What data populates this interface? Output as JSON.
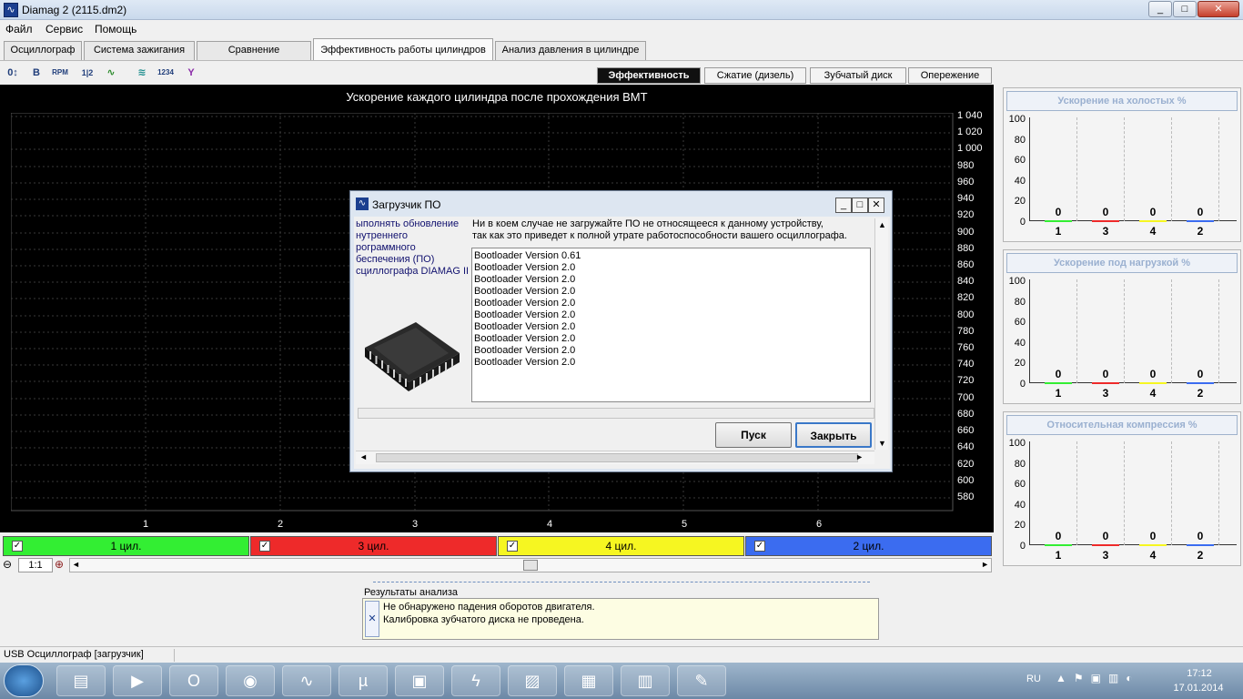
{
  "window": {
    "title": "Diamag 2 (2115.dm2)",
    "app_icon": "oscilloscope-wave-icon",
    "min": "_",
    "max": "□",
    "close": "✕"
  },
  "menu": [
    "Файл",
    "Сервис",
    "Помощь"
  ],
  "tabs": [
    "Осциллограф",
    "Система зажигания",
    "Сравнение цилиндров",
    "Эффективность работы цилиндров",
    "Анализ давления в цилиндре"
  ],
  "active_tab": 3,
  "toolbar": {
    "tools": [
      "0↕",
      "B",
      "RPM",
      "1|2",
      "∿",
      "≋",
      "1234",
      "Y"
    ],
    "subtabs": [
      "Эффективность",
      "Сжатие (дизель)",
      "Зубчатый диск",
      "Опережение"
    ],
    "active_subtab": 0
  },
  "chart": {
    "title": "Ускорение каждого цилиндра после прохождения ВМТ",
    "background": "#000000"
  },
  "chart_data": {
    "type": "bar",
    "title": "Ускорение каждого цилиндра после прохождения ВМТ",
    "categories": [
      "1",
      "2",
      "3",
      "4",
      "5",
      "6"
    ],
    "yticks": [
      "1 040",
      "1 020",
      "1 000",
      "980",
      "960",
      "940",
      "920",
      "900",
      "880",
      "860",
      "840",
      "820",
      "800",
      "780",
      "760",
      "740",
      "720",
      "700",
      "680",
      "660",
      "640",
      "620",
      "600",
      "580"
    ],
    "ylim": [
      580,
      1040
    ],
    "values": []
  },
  "cylinders": [
    {
      "label": "1 цил.",
      "color": "#33ee33"
    },
    {
      "label": "3 цил.",
      "color": "#ee2a2a"
    },
    {
      "label": "4 цил.",
      "color": "#f6f621"
    },
    {
      "label": "2 цил.",
      "color": "#3b6cf0"
    }
  ],
  "checkbox_mark": "✓",
  "scroll": {
    "zoom": "1:1",
    "zoom_out": "⊖",
    "zoom_in": "⊕",
    "left": "◄",
    "right": "►"
  },
  "mini_charts": [
    {
      "title": "Ускорение на холостых %",
      "yticks": [
        "100",
        "80",
        "60",
        "40",
        "20",
        "0"
      ],
      "xlabels": [
        "1",
        "3",
        "4",
        "2"
      ],
      "values": [
        "0",
        "0",
        "0",
        "0"
      ]
    },
    {
      "title": "Ускорение под нагрузкой %",
      "yticks": [
        "100",
        "80",
        "60",
        "40",
        "20",
        "0"
      ],
      "xlabels": [
        "1",
        "3",
        "4",
        "2"
      ],
      "values": [
        "0",
        "0",
        "0",
        "0"
      ]
    },
    {
      "title": "Относительная компрессия %",
      "yticks": [
        "100",
        "80",
        "60",
        "40",
        "20",
        "0"
      ],
      "xlabels": [
        "1",
        "3",
        "4",
        "2"
      ],
      "values": [
        "0",
        "0",
        "0",
        "0"
      ]
    }
  ],
  "results": {
    "title": "Результаты анализа",
    "lines": [
      "Не обнаружено падения оборотов двигателя.",
      "Калибровка зубчатого диска не проведена."
    ],
    "close": "✕"
  },
  "status": "USB Осциллограф [загрузчик]",
  "dialog": {
    "title": "Загрузчик ПО",
    "left_lines": [
      "ыполнять обновление",
      "нутреннего",
      "рограммного",
      "беспечения (ПО)",
      "сциллографа DIAMAG II."
    ],
    "warn_lines": [
      "Ни в коем случае не загружайте ПО не относящееся к данному устройству,",
      "так как это приведет к полной утрате работоспособности вашего осциллографа."
    ],
    "list": [
      "Bootloader Version 0.61",
      "Bootloader Version 2.0",
      "Bootloader Version 2.0",
      "Bootloader Version 2.0",
      "Bootloader Version 2.0",
      "Bootloader Version 2.0",
      "Bootloader Version 2.0",
      "Bootloader Version 2.0",
      "Bootloader Version 2.0",
      "Bootloader Version 2.0"
    ],
    "start": "Пуск",
    "close_btn": "Закрыть",
    "min": "_",
    "max": "□",
    "x": "✕"
  },
  "taskbar": {
    "apps": [
      "folder-icon",
      "media-player-icon",
      "opera-icon",
      "chrome-icon",
      "diamag-icon",
      "utorrent-icon",
      "save-icon",
      "lightning-icon",
      "notes-icon",
      "calculator-icon",
      "winrar-icon",
      "paint-icon"
    ],
    "lang": "RU",
    "time": "17:12",
    "date": "17.01.2014"
  }
}
